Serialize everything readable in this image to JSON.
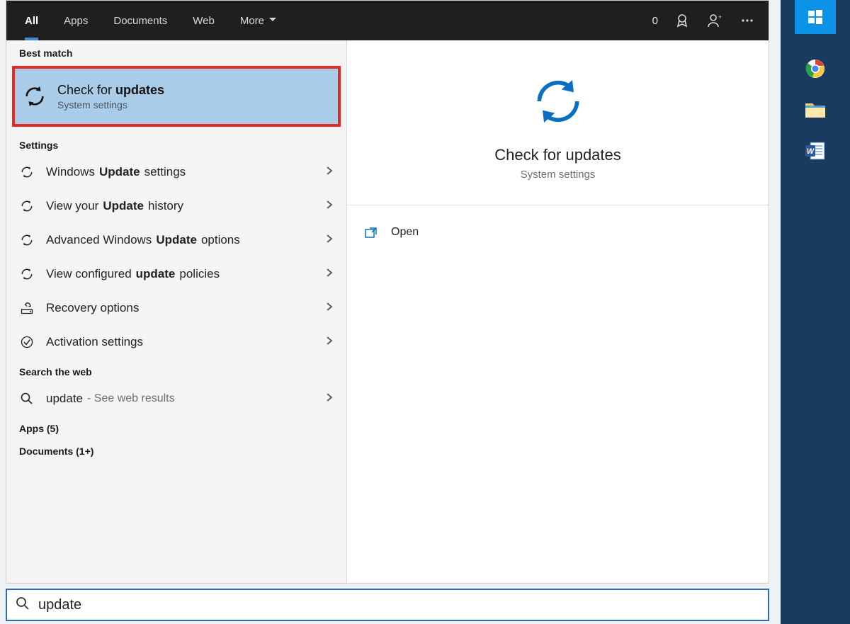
{
  "topbar": {
    "tabs": [
      "All",
      "Apps",
      "Documents",
      "Web",
      "More"
    ],
    "active_index": 0,
    "rewards_count": "0"
  },
  "left": {
    "best_match_label": "Best match",
    "best_match": {
      "title_pre": "Check for ",
      "title_bold": "updates",
      "subtitle": "System settings"
    },
    "settings_label": "Settings",
    "settings": [
      {
        "pre": "Windows ",
        "bold": "Update",
        "post": " settings",
        "icon": "refresh"
      },
      {
        "pre": "View your ",
        "bold": "Update",
        "post": " history",
        "icon": "refresh"
      },
      {
        "pre": "Advanced Windows ",
        "bold": "Update",
        "post": " options",
        "icon": "refresh"
      },
      {
        "pre": "View configured ",
        "bold": "update",
        "post": " policies",
        "icon": "refresh"
      },
      {
        "pre": "Recovery options",
        "bold": "",
        "post": "",
        "icon": "recovery"
      },
      {
        "pre": "Activation settings",
        "bold": "",
        "post": "",
        "icon": "check"
      }
    ],
    "web_label": "Search the web",
    "web": {
      "query": "update",
      "suffix": " - See web results"
    },
    "apps_label": "Apps (5)",
    "docs_label": "Documents (1+)"
  },
  "right": {
    "title": "Check for updates",
    "subtitle": "System settings",
    "open_label": "Open"
  },
  "search": {
    "value": "update"
  },
  "taskbar": {
    "apps": [
      "chrome",
      "explorer",
      "word"
    ]
  }
}
